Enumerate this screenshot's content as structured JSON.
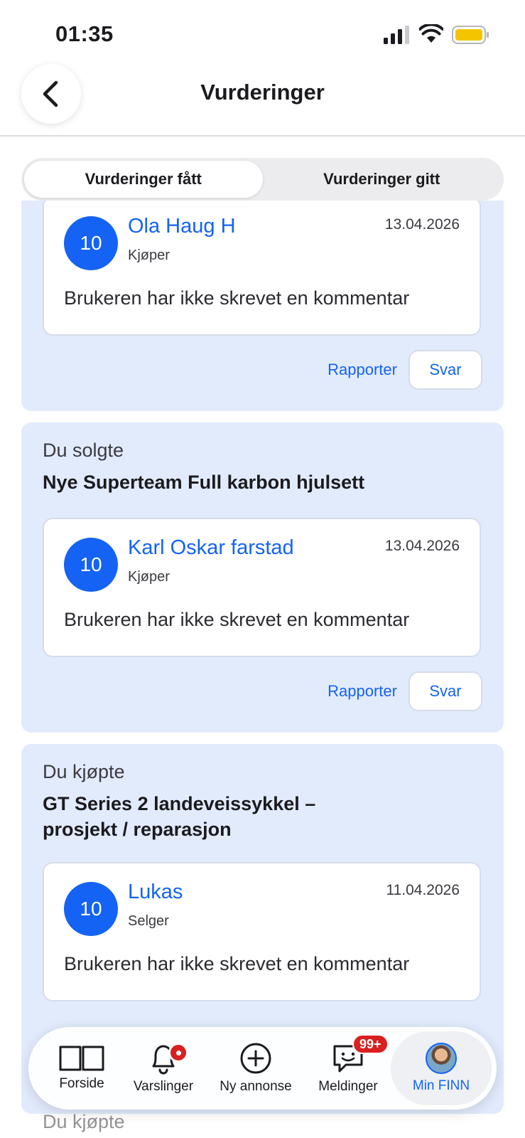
{
  "status_bar": {
    "time": "01:35"
  },
  "header": {
    "title": "Vurderinger"
  },
  "tabs": [
    {
      "label": "Vurderinger fått",
      "active": true
    },
    {
      "label": "Vurderinger gitt",
      "active": false
    }
  ],
  "reviews": [
    {
      "kicker": "",
      "item_title": "",
      "score": "10",
      "reviewer": "Ola Haug H",
      "role": "Kjøper",
      "date": "13.04.2026",
      "comment": "Brukeren har ikke skrevet en kommentar",
      "report_label": "Rapporter",
      "reply_label": "Svar"
    },
    {
      "kicker": "Du solgte",
      "item_title": "Nye Superteam Full karbon hjulsett",
      "score": "10",
      "reviewer": "Karl Oskar farstad",
      "role": "Kjøper",
      "date": "13.04.2026",
      "comment": "Brukeren har ikke skrevet en kommentar",
      "report_label": "Rapporter",
      "reply_label": "Svar"
    },
    {
      "kicker": "Du kjøpte",
      "item_title": "GT Series 2 landeveissykkel – prosjekt / reparasjon",
      "score": "10",
      "reviewer": "Lukas",
      "role": "Selger",
      "date": "11.04.2026",
      "comment": "Brukeren har ikke skrevet en kommentar"
    }
  ],
  "next_section_kicker": "Du kjøpte",
  "bottom_nav": {
    "home_label": "Forside",
    "notifications_label": "Varslinger",
    "new_ad_label": "Ny annonse",
    "messages_label": "Meldinger",
    "messages_badge": "99+",
    "profile_label": "Min FINN"
  },
  "colors": {
    "accent": "#1463f5",
    "section_bg": "#e2ebfc",
    "badge": "#d91f1f",
    "battery": "#f5c400"
  },
  "icons": [
    "back-arrow-icon",
    "signal-icon",
    "wifi-icon",
    "battery-icon",
    "book-icon",
    "bell-icon",
    "plus-circle-icon",
    "chat-icon",
    "avatar"
  ]
}
